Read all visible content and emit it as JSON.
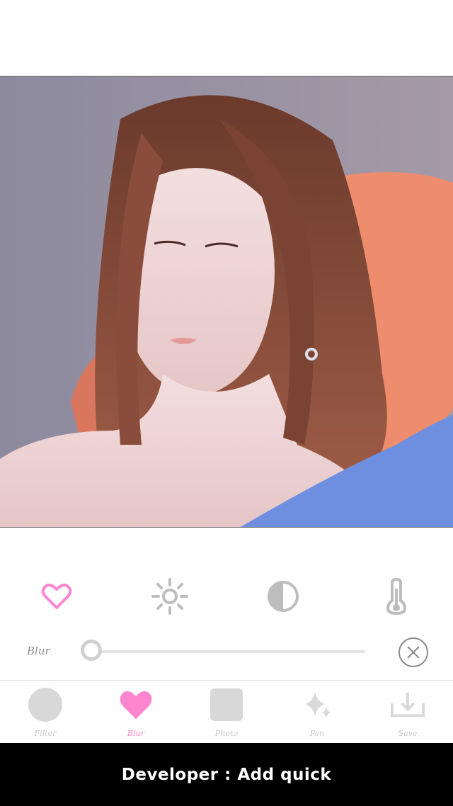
{
  "colors": {
    "accent_pink": "#ff85cf",
    "icon_gray": "#bdbdbd",
    "inactive_label": "#c8c8c8",
    "banner_bg": "#000000"
  },
  "photo": {
    "subject": "woman with long auburn hair on orange chair"
  },
  "tools": [
    {
      "icon": "heart-outline-icon",
      "active": true
    },
    {
      "icon": "brightness-icon",
      "active": false
    },
    {
      "icon": "contrast-icon",
      "active": false
    },
    {
      "icon": "thermometer-icon",
      "active": false
    }
  ],
  "slider": {
    "label": "Blur",
    "value": 0
  },
  "tabs": [
    {
      "label": "Filter",
      "icon": "circle-icon",
      "active": false
    },
    {
      "label": "Blur",
      "icon": "heart-icon",
      "active": true
    },
    {
      "label": "Photo",
      "icon": "square-icon",
      "active": false
    },
    {
      "label": "Pen",
      "icon": "sparkle-icon",
      "active": false
    },
    {
      "label": "Save",
      "icon": "download-icon",
      "active": false
    }
  ],
  "banner": {
    "text": "Developer : Add quick"
  }
}
